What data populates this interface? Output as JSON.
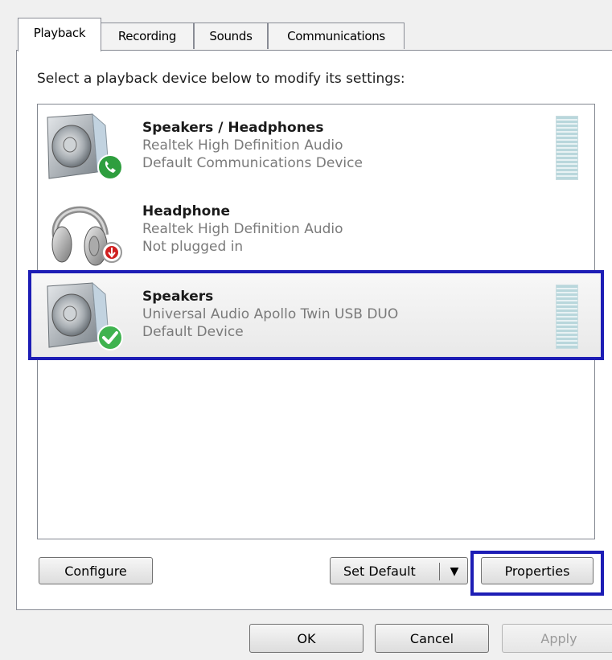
{
  "tabs": [
    {
      "label": "Playback",
      "active": true
    },
    {
      "label": "Recording",
      "active": false
    },
    {
      "label": "Sounds",
      "active": false
    },
    {
      "label": "Communications",
      "active": false
    }
  ],
  "instruction": "Select a playback device below to modify its settings:",
  "devices": [
    {
      "name": "Speakers / Headphones",
      "driver": "Realtek High Definition Audio",
      "status": "Default Communications Device",
      "icon": "speaker-icon",
      "badge": "phone-badge-icon",
      "selected": false
    },
    {
      "name": "Headphone",
      "driver": "Realtek High Definition Audio",
      "status": "Not plugged in",
      "icon": "headphone-icon",
      "badge": "unplugged-badge-icon",
      "selected": false
    },
    {
      "name": "Speakers",
      "driver": "Universal Audio Apollo Twin USB DUO",
      "status": "Default Device",
      "icon": "speaker-icon",
      "badge": "checkmark-badge-icon",
      "selected": true
    }
  ],
  "buttons": {
    "configure": "Configure",
    "set_default": "Set Default",
    "properties": "Properties",
    "ok": "OK",
    "cancel": "Cancel",
    "apply": "Apply"
  },
  "colors": {
    "highlight": "#1d1db5",
    "phone_badge": "#2e9e3e",
    "check_badge": "#3fb34f",
    "unplugged_badge": "#d02020"
  }
}
